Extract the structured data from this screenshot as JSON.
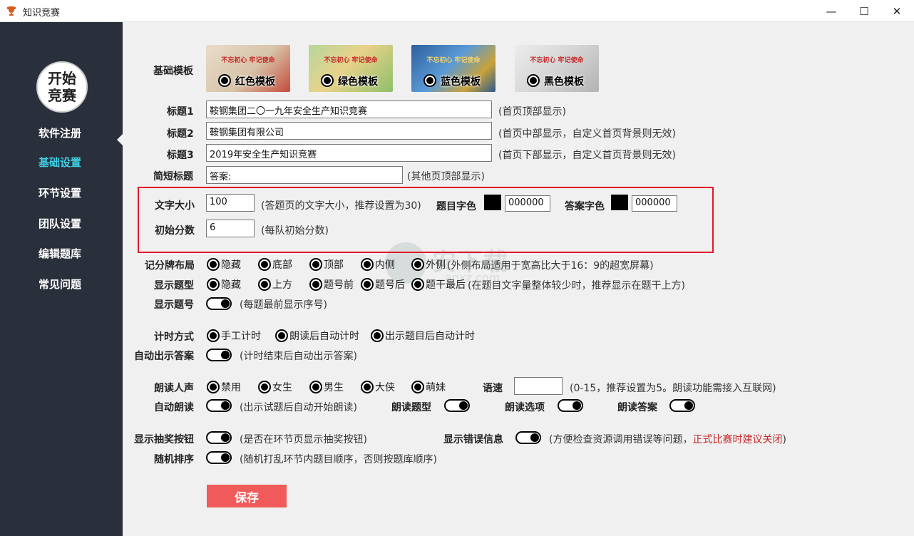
{
  "window": {
    "title": "知识竞赛",
    "minimize": "—",
    "maximize": "☐",
    "close": "✕"
  },
  "sidebar": {
    "logo": "开始竞赛",
    "items": [
      {
        "label": "软件注册"
      },
      {
        "label": "基础设置",
        "active": true
      },
      {
        "label": "环节设置"
      },
      {
        "label": "团队设置"
      },
      {
        "label": "编辑题库"
      },
      {
        "label": "常见问题"
      }
    ]
  },
  "templates": {
    "label": "基础模板",
    "options": [
      {
        "name": "红色模板",
        "headline": "不忘初心 牢记使命",
        "bg": "#d9cbb8"
      },
      {
        "name": "绿色模板",
        "headline": "不忘初心 牢记使命",
        "bg": "#9dc58a"
      },
      {
        "name": "蓝色模板",
        "headline": "不忘初心 牢记使命",
        "bg": "#3d78b8"
      },
      {
        "name": "黑色模板",
        "headline": "不忘初心 牢记使命",
        "bg": "#c9c9c9"
      }
    ]
  },
  "titles": {
    "title1": {
      "label": "标题1",
      "value": "鞍钢集团二〇一九年安全生产知识竞赛",
      "note": "(首页顶部显示)"
    },
    "title2": {
      "label": "标题2",
      "value": "鞍钢集团有限公司",
      "note": "(首页中部显示，自定义首页背景则无效)"
    },
    "title3": {
      "label": "标题3",
      "value": "2019年安全生产知识竞赛",
      "note": "(首页下部显示，自定义首页背景则无效)"
    },
    "short": {
      "label": "简短标题",
      "value": "答案:",
      "note": "(其他页顶部显示)"
    }
  },
  "font_settings": {
    "size_label": "文字大小",
    "size_value": "100",
    "size_note": "(答题页的文字大小，推荐设置为30)",
    "q_color_label": "题目字色",
    "q_color_value": "000000",
    "a_color_label": "答案字色",
    "a_color_value": "000000",
    "init_score_label": "初始分数",
    "init_score_value": "6",
    "init_score_note": "(每队初始分数)"
  },
  "scoreboard": {
    "label": "记分牌布局",
    "options": [
      "隐藏",
      "底部",
      "顶部",
      "内侧",
      "外侧"
    ],
    "note": "(外侧布局适用于宽高比大于16：9的超宽屏幕)"
  },
  "question_type": {
    "label": "显示题型",
    "options": [
      "隐藏",
      "上方",
      "题号前",
      "题号后",
      "题干最后"
    ],
    "note": "(在题目文字量整体较少时，推荐显示在题干上方)"
  },
  "question_number": {
    "label": "显示题号",
    "note": "(每题最前显示序号)"
  },
  "timing": {
    "label": "计时方式",
    "options": [
      "手工计时",
      "朗读后自动计时",
      "出示题目后自动计时"
    ]
  },
  "auto_answer": {
    "label": "自动出示答案",
    "note": "(计时结束后自动出示答案)"
  },
  "voice": {
    "label": "朗读人声",
    "options": [
      "禁用",
      "女生",
      "男生",
      "大侠",
      "萌妹"
    ],
    "speed_label": "语速",
    "speed_value": "",
    "speed_note": "(0-15，推荐设置为5。朗读功能需接入互联网)"
  },
  "auto_read": {
    "label": "自动朗读",
    "note": "(出示试题后自动开始朗读)",
    "type_label": "朗读题型",
    "options_label": "朗读选项",
    "answer_label": "朗读答案"
  },
  "lottery": {
    "label": "显示抽奖按钮",
    "note": "(是否在环节页显示抽奖按钮)"
  },
  "errors": {
    "label": "显示错误信息",
    "note": "(方便检查资源调用错误等问题，",
    "warn": "正式比赛时建议关闭",
    "note_end": ")"
  },
  "shuffle": {
    "label": "随机排序",
    "note": "(随机打乱环节内题目顺序，否则按题库顺序)"
  },
  "save_label": "保存",
  "watermark": {
    "text": "安下载",
    "sub": "anxz.com"
  }
}
